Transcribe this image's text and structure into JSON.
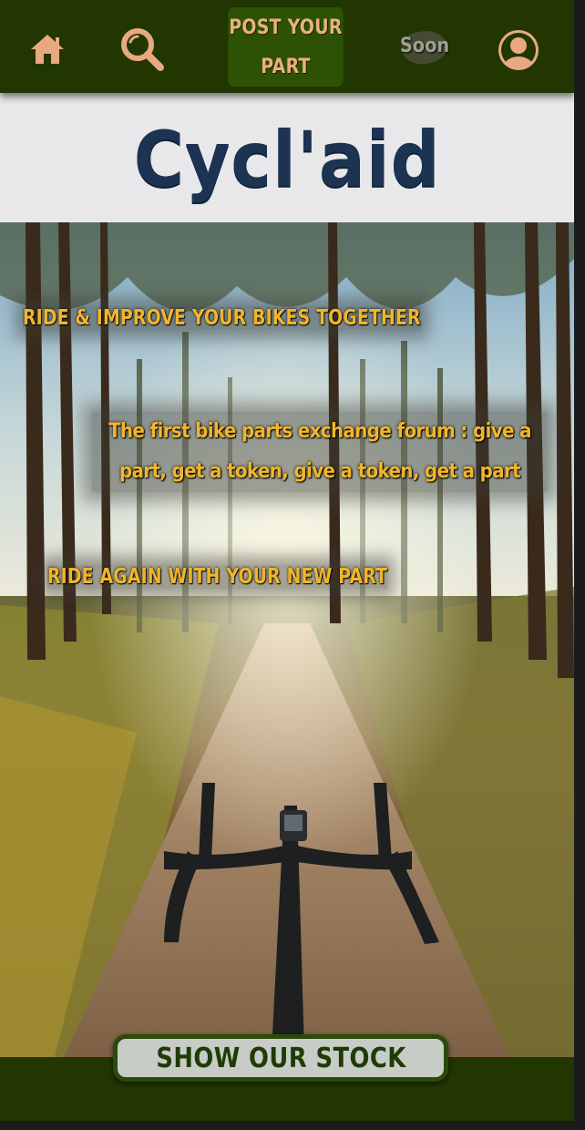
{
  "colors": {
    "nav_background": "#213600",
    "nav_icon": "#e8a980",
    "post_button_bg": "#2d5206",
    "title_band_bg": "#e8e8ea",
    "title_color": "#1c3352",
    "tagline_color": "#f0b52b",
    "stock_button_bg": "#c7ccc7",
    "stock_button_text": "#1f3b07"
  },
  "nav": {
    "home_icon": "home-icon",
    "search_icon": "search-icon",
    "post_line1": "POST YOUR",
    "post_line2": "PART",
    "soon_label": "Soon",
    "account_icon": "user-circle-icon"
  },
  "header": {
    "site_title": "Cycl'aid"
  },
  "hero": {
    "tagline_1": "RIDE & IMPROVE YOUR BIKES TOGETHER",
    "tagline_2": "The first bike parts exchange forum : give a part, get a token, give a token, get a part",
    "tagline_3": "RIDE AGAIN WITH YOUR NEW PART"
  },
  "footer": {
    "stock_button_label": "SHOW OUR STOCK"
  }
}
